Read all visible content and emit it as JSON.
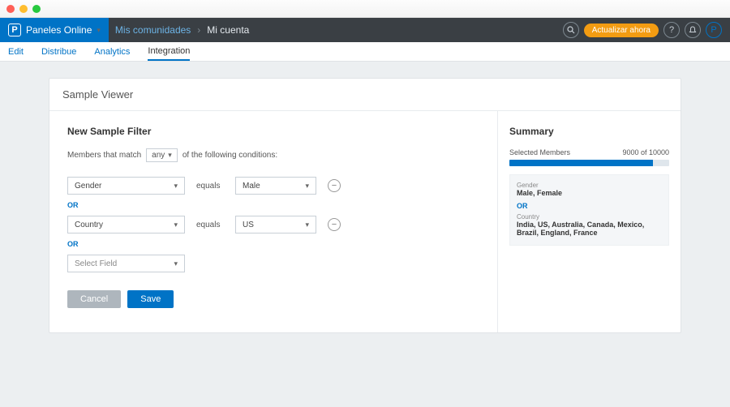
{
  "brand": {
    "mark": "P",
    "name": "Paneles Online"
  },
  "breadcrumb": {
    "first": "Mis comunidades",
    "second": "Mi cuenta"
  },
  "cta_pill": "Actualizar ahora",
  "subnav": {
    "edit": "Edit",
    "distribute": "Distribue",
    "analytics": "Analytics",
    "integration": "Integration"
  },
  "panel_title": "Sample Viewer",
  "filter": {
    "title": "New Sample Filter",
    "match_prefix": "Members that match",
    "match_scope": "any",
    "match_suffix": "of the following conditions:",
    "equals_label": "equals",
    "or_label": "OR",
    "rows": [
      {
        "field": "Gender",
        "value": "Male"
      },
      {
        "field": "Country",
        "value": "US"
      }
    ],
    "placeholder_field": "Select Field",
    "cancel": "Cancel",
    "save": "Save"
  },
  "summary": {
    "title": "Summary",
    "selected_label": "Selected Members",
    "selected_value": "9000 of 10000",
    "progress_pct": 90,
    "blocks": [
      {
        "label": "Gender",
        "value": "Male, Female"
      },
      {
        "label": "Country",
        "value": "India, US, Australia, Canada, Mexico, Brazil, England, France"
      }
    ]
  }
}
